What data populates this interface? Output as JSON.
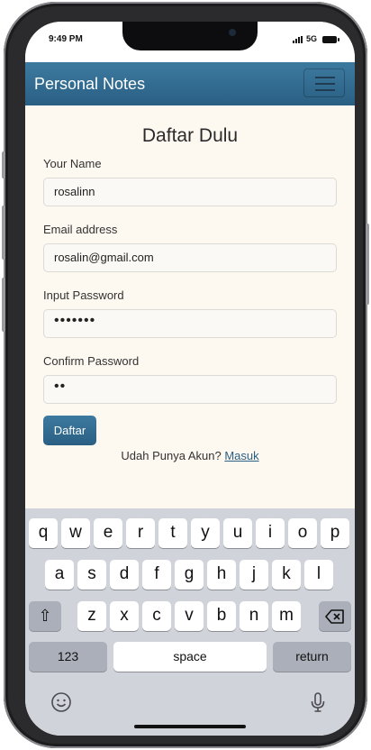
{
  "status": {
    "time": "9:49 PM",
    "network": "5G"
  },
  "navbar": {
    "brand": "Personal Notes"
  },
  "form": {
    "title": "Daftar Dulu",
    "fields": [
      {
        "label": "Your Name",
        "value": "rosalinn"
      },
      {
        "label": "Email address",
        "value": "rosalin@gmail.com"
      },
      {
        "label": "Input Password",
        "value": "•••••••"
      },
      {
        "label": "Confirm Password",
        "value": "••"
      }
    ],
    "submit_label": "Daftar",
    "have_account_text": "Udah Punya Akun?",
    "login_link": "Masuk"
  },
  "keyboard": {
    "row1": [
      "q",
      "w",
      "e",
      "r",
      "t",
      "y",
      "u",
      "i",
      "o",
      "p"
    ],
    "row2": [
      "a",
      "s",
      "d",
      "f",
      "g",
      "h",
      "j",
      "k",
      "l"
    ],
    "row3": [
      "z",
      "x",
      "c",
      "v",
      "b",
      "n",
      "m"
    ],
    "shift": "⇧",
    "numbers": "123",
    "space": "space",
    "return": "return"
  }
}
